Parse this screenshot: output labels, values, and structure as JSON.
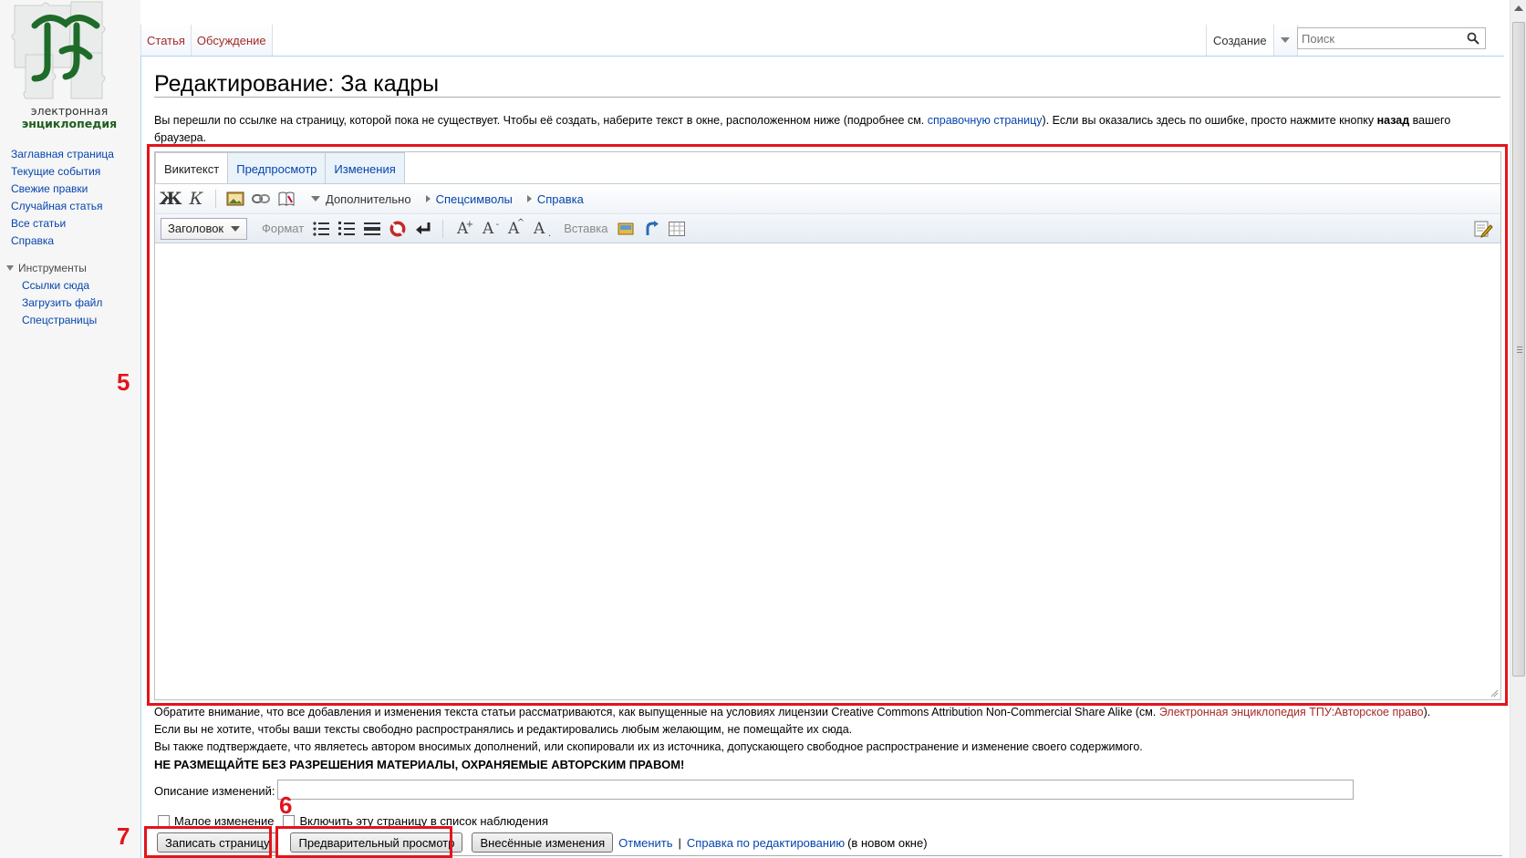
{
  "logo": {
    "line1": "электронная",
    "line2": "энциклопедия"
  },
  "sidebar": {
    "nav": [
      {
        "label": "Заглавная страница"
      },
      {
        "label": "Текущие события"
      },
      {
        "label": "Свежие правки"
      },
      {
        "label": "Случайная статья"
      },
      {
        "label": "Все статьи"
      },
      {
        "label": "Справка"
      }
    ],
    "tools_heading": "Инструменты",
    "tools": [
      {
        "label": "Ссылки сюда"
      },
      {
        "label": "Загрузить файл"
      },
      {
        "label": "Спецстраницы"
      }
    ]
  },
  "page_tabs": {
    "article": "Статья",
    "discussion": "Обсуждение",
    "create": "Создание"
  },
  "search": {
    "placeholder": "Поиск"
  },
  "heading": "Редактирование: За кадры",
  "intro": {
    "part1": "Вы перешли по ссылке на страницу, которой пока не существует. Чтобы её создать, наберите текст в окне, расположенном ниже (подробнее см. ",
    "help_link": "справочную страницу",
    "part2": "). Если вы оказались здесь по ошибке, просто нажмите кнопку ",
    "bold": "назад",
    "part3": " вашего браузера."
  },
  "editor": {
    "tabs": [
      "Викитекст",
      "Предпросмотр",
      "Изменения"
    ],
    "bold_glyph": "Ж",
    "italic_glyph": "К",
    "advanced": "Дополнительно",
    "special_chars": "Спецсимволы",
    "help": "Справка",
    "heading_select": "Заголовок",
    "format_label": "Формат",
    "insert_label": "Вставка",
    "text": ""
  },
  "annotations": {
    "five": "5",
    "six": "6",
    "seven": "7"
  },
  "license": {
    "line1_pre": "Обратите внимание, что все добавления и изменения текста статьи рассматриваются, как выпущенные на условиях лицензии Creative Commons Attribution Non-Commercial Share Alike (см. ",
    "line1_link": "Электронная энциклопедия ТПУ:Авторское право",
    "line1_post": ").",
    "line2": "Если вы не хотите, чтобы ваши тексты свободно распространялись и редактировались любым желающим, не помещайте их сюда.",
    "line3": "Вы также подтверждаете, что являетесь автором вносимых дополнений, или скопировали их из источника, допускающего свободное распространение и изменение своего содержимого.",
    "warning": "НЕ РАЗМЕЩАЙТЕ БЕЗ РАЗРЕШЕНИЯ МАТЕРИАЛЫ, ОХРАНЯЕМЫЕ АВТОРСКИМ ПРАВОМ!"
  },
  "summary": {
    "label": "Описание изменений:",
    "value": ""
  },
  "checkboxes": {
    "minor": "Малое изменение",
    "watch": "Включить эту страницу в список наблюдения"
  },
  "buttons": {
    "save": "Записать страницу",
    "preview": "Предварительный просмотр",
    "diff": "Внесённые изменения",
    "cancel": "Отменить",
    "sep": "|",
    "edit_help": "Справка по редактированию",
    "new_window": "(в новом окне)"
  },
  "colors": {
    "annotation_red": "#e3141c",
    "link": "#0645ad",
    "new_link": "#a42b28",
    "logo_green": "#1e5e1e"
  }
}
